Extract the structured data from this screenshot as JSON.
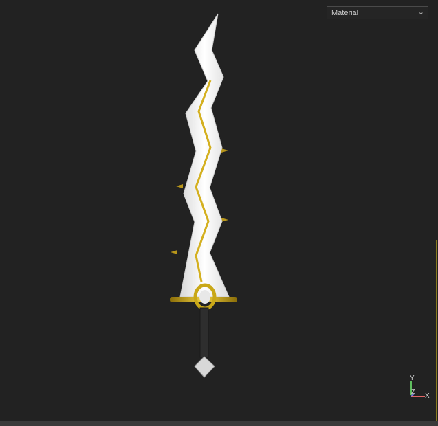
{
  "toolbar": {
    "material_select": {
      "selected": "Material",
      "icon": "chevron-down-icon"
    }
  },
  "axis_gizmo": {
    "x_label": "X",
    "y_label": "Y",
    "z_label": "Z",
    "x_color": "#e06666",
    "y_color": "#5fbf5f",
    "z_color": "#7777dd"
  },
  "colors": {
    "background": "#222222",
    "blade": "#f0f0f0",
    "gold": "#c9a818"
  }
}
